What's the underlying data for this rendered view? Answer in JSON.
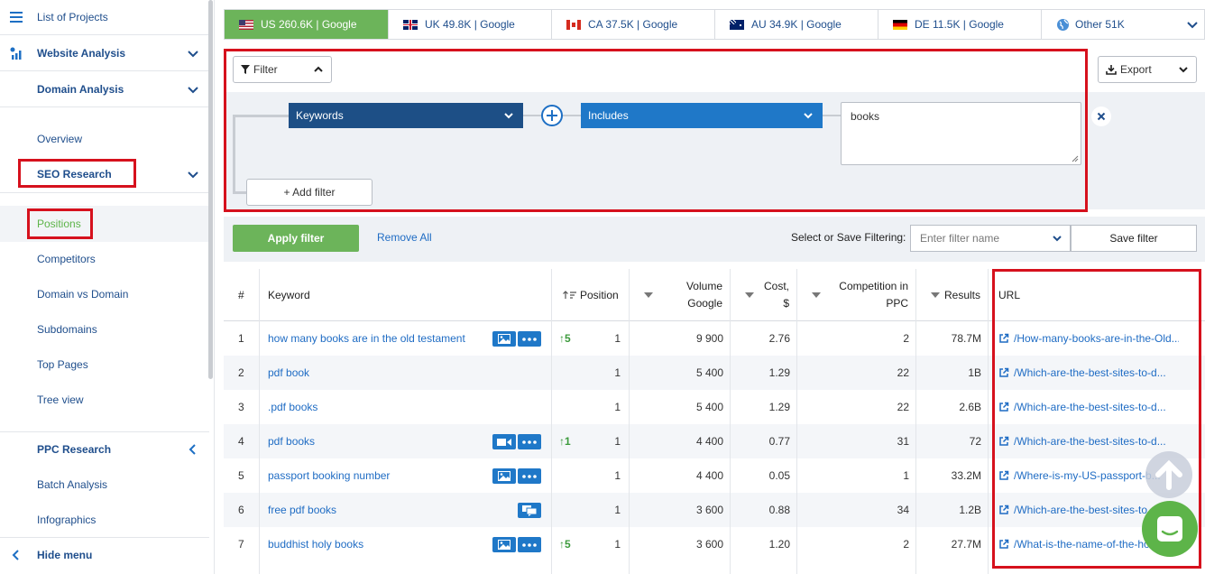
{
  "sidebar": {
    "list_projects": "List of Projects",
    "website_analysis": "Website Analysis",
    "domain_analysis": "Domain Analysis",
    "overview": "Overview",
    "seo_research": "SEO Research",
    "positions": "Positions",
    "competitors": "Competitors",
    "domain_vs_domain": "Domain vs Domain",
    "subdomains": "Subdomains",
    "top_pages": "Top Pages",
    "tree_view": "Tree view",
    "ppc_research": "PPC Research",
    "batch_analysis": "Batch Analysis",
    "infographics": "Infographics",
    "hide_menu": "Hide menu"
  },
  "tabs": [
    {
      "label": "US 260.6K | Google",
      "flag": "us-flag"
    },
    {
      "label": "UK 49.8K | Google",
      "flag": "uk-flag"
    },
    {
      "label": "CA 37.5K | Google",
      "flag": "ca-flag"
    },
    {
      "label": "AU 34.9K | Google",
      "flag": "au-flag"
    },
    {
      "label": "DE 11.5K | Google",
      "flag": "de-flag"
    },
    {
      "label": "Other 51K",
      "flag": "globe-icon"
    }
  ],
  "filter": {
    "button_label": "Filter",
    "export_label": "Export",
    "field": "Keywords",
    "condition": "Includes",
    "value": "books",
    "add_filter": "+ Add filter",
    "apply": "Apply filter",
    "remove_all": "Remove All",
    "save_label": "Select or Save Filtering:",
    "name_placeholder": "Enter filter name",
    "save_filter": "Save filter"
  },
  "table": {
    "headers": {
      "num": "#",
      "keyword": "Keyword",
      "position": "Position",
      "volume_1": "Volume",
      "volume_2": "Google",
      "cost_1": "Cost,",
      "cost_2": "$",
      "comp_1": "Competition in",
      "comp_2": "PPC",
      "results": "Results",
      "url": "URL"
    },
    "rows": [
      {
        "num": "1",
        "keyword": "how many books are in the old testament",
        "chips": [
          "image-icon",
          "more-icon"
        ],
        "change": "5",
        "position": "1",
        "volume": "9 900",
        "cost": "2.76",
        "comp": "2",
        "results": "78.7M",
        "url": "/How-many-books-are-in-the-Old..."
      },
      {
        "num": "2",
        "keyword": "pdf book",
        "chips": [],
        "change": "",
        "position": "1",
        "volume": "5 400",
        "cost": "1.29",
        "comp": "22",
        "results": "1B",
        "url": "/Which-are-the-best-sites-to-d..."
      },
      {
        "num": "3",
        "keyword": ".pdf books",
        "chips": [],
        "change": "",
        "position": "1",
        "volume": "5 400",
        "cost": "1.29",
        "comp": "22",
        "results": "2.6B",
        "url": "/Which-are-the-best-sites-to-d..."
      },
      {
        "num": "4",
        "keyword": "pdf books",
        "chips": [
          "video-icon",
          "more-icon"
        ],
        "change": "1",
        "position": "1",
        "volume": "4 400",
        "cost": "0.77",
        "comp": "31",
        "results": "72",
        "url": "/Which-are-the-best-sites-to-d..."
      },
      {
        "num": "5",
        "keyword": "passport booking number",
        "chips": [
          "image-icon",
          "more-icon"
        ],
        "change": "",
        "position": "1",
        "volume": "4 400",
        "cost": "0.05",
        "comp": "1",
        "results": "33.2M",
        "url": "/Where-is-my-US-passport-b..."
      },
      {
        "num": "6",
        "keyword": "free pdf books",
        "chips": [
          "chat-icon"
        ],
        "change": "",
        "position": "1",
        "volume": "3 600",
        "cost": "0.88",
        "comp": "34",
        "results": "1.2B",
        "url": "/Which-are-the-best-sites-to..."
      },
      {
        "num": "7",
        "keyword": "buddhist holy books",
        "chips": [
          "image-icon",
          "more-icon"
        ],
        "change": "5",
        "position": "1",
        "volume": "3 600",
        "cost": "1.20",
        "comp": "2",
        "results": "27.7M",
        "url": "/What-is-the-name-of-the-ho..."
      }
    ]
  }
}
